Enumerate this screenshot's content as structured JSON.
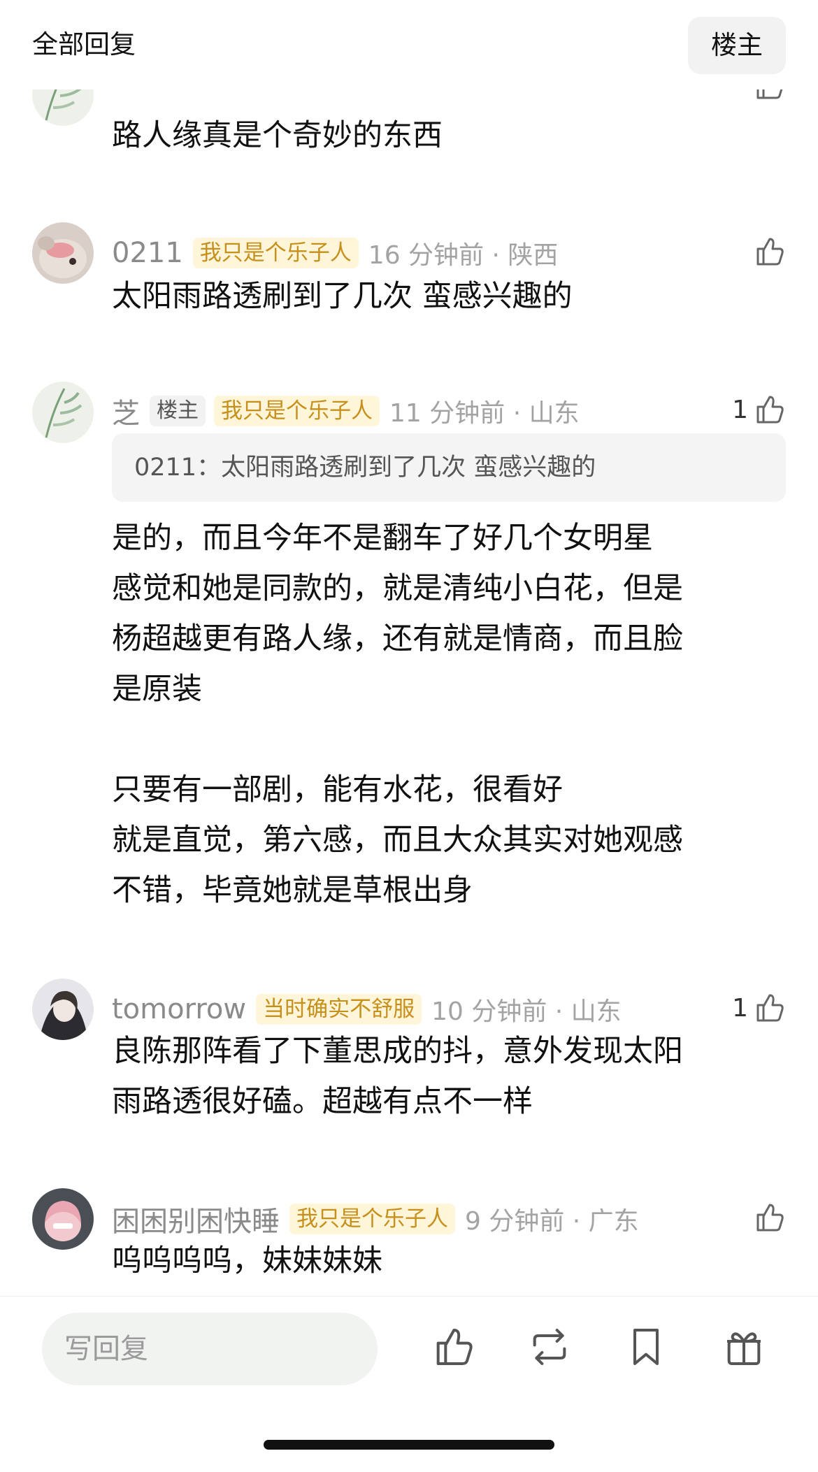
{
  "header": {
    "title": "全部回复",
    "op_button": "楼主"
  },
  "comments": [
    {
      "text": "路人缘真是个奇妙的东西"
    },
    {
      "username": "0211",
      "badge": "我只是个乐子人",
      "time": "16 分钟前 · 陕西",
      "text": "太阳雨路透刷到了几次 蛮感兴趣的"
    },
    {
      "username": "芝",
      "op_tag": "楼主",
      "badge": "我只是个乐子人",
      "time": "11 分钟前 · 山东",
      "likes": "1",
      "quote": "0211：太阳雨路透刷到了几次 蛮感兴趣的",
      "text": "是的，而且今年不是翻车了好几个女明星\n感觉和她是同款的，就是清纯小白花，但是\n杨超越更有路人缘，还有就是情商，而且脸\n是原装\n\n只要有一部剧，能有水花，很看好\n就是直觉，第六感，而且大众其实对她观感\n不错，毕竟她就是草根出身"
    },
    {
      "username": "tomorrow",
      "badge": "当时确实不舒服",
      "time": "10 分钟前 · 山东",
      "likes": "1",
      "text": "良陈那阵看了下董思成的抖，意外发现太阳\n雨路透很好磕。超越有点不一样"
    },
    {
      "username": "困困别困快睡",
      "badge": "我只是个乐子人",
      "time": "9 分钟前 · 广东",
      "text": "呜呜呜呜，妹妹妹妹"
    }
  ],
  "bottom_bar": {
    "reply_placeholder": "写回复",
    "icons": [
      "like-icon",
      "repost-icon",
      "bookmark-icon",
      "gift-icon"
    ]
  },
  "colors": {
    "badge_text": "#c7901c",
    "badge_bg": "#fff5d9",
    "meta_gray": "#a3a3a3"
  }
}
